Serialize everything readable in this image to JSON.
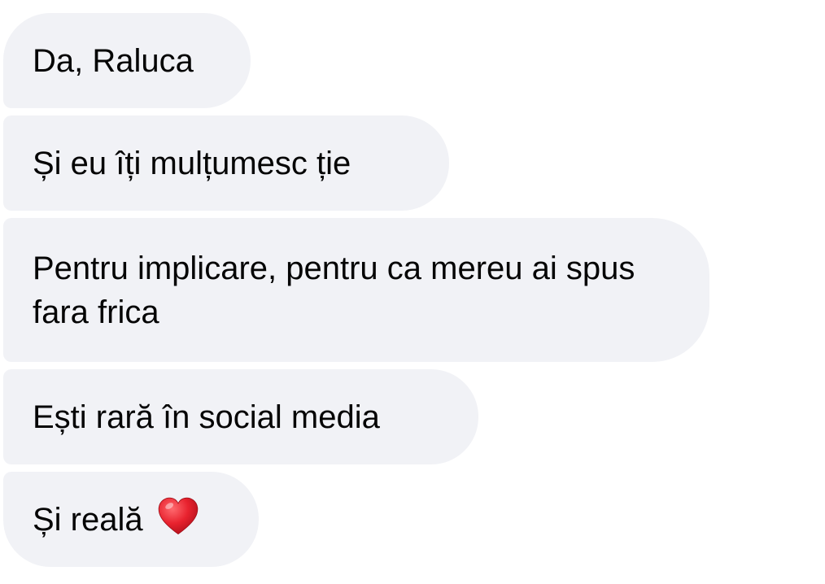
{
  "messages": [
    {
      "text": "Da, Raluca"
    },
    {
      "text": "Și eu îți mulțumesc ție"
    },
    {
      "text": "Pentru implicare, pentru ca mereu ai spus fara frica"
    },
    {
      "text": "Ești rară în social media"
    },
    {
      "text": "Și reală",
      "emoji": "heart-icon"
    }
  ],
  "colors": {
    "bubble_background": "#f1f2f6",
    "text": "#050505",
    "heart": "#e8222e"
  }
}
